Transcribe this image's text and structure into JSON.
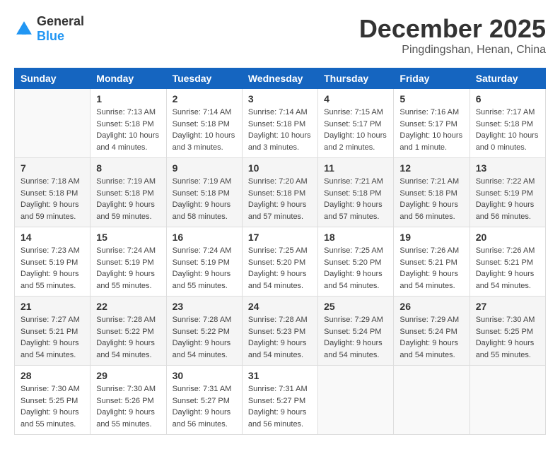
{
  "header": {
    "logo_general": "General",
    "logo_blue": "Blue",
    "month_title": "December 2025",
    "location": "Pingdingshan, Henan, China"
  },
  "weekdays": [
    "Sunday",
    "Monday",
    "Tuesday",
    "Wednesday",
    "Thursday",
    "Friday",
    "Saturday"
  ],
  "weeks": [
    [
      {
        "day": "",
        "info": ""
      },
      {
        "day": "1",
        "info": "Sunrise: 7:13 AM\nSunset: 5:18 PM\nDaylight: 10 hours\nand 4 minutes."
      },
      {
        "day": "2",
        "info": "Sunrise: 7:14 AM\nSunset: 5:18 PM\nDaylight: 10 hours\nand 3 minutes."
      },
      {
        "day": "3",
        "info": "Sunrise: 7:14 AM\nSunset: 5:18 PM\nDaylight: 10 hours\nand 3 minutes."
      },
      {
        "day": "4",
        "info": "Sunrise: 7:15 AM\nSunset: 5:17 PM\nDaylight: 10 hours\nand 2 minutes."
      },
      {
        "day": "5",
        "info": "Sunrise: 7:16 AM\nSunset: 5:17 PM\nDaylight: 10 hours\nand 1 minute."
      },
      {
        "day": "6",
        "info": "Sunrise: 7:17 AM\nSunset: 5:18 PM\nDaylight: 10 hours\nand 0 minutes."
      }
    ],
    [
      {
        "day": "7",
        "info": "Sunrise: 7:18 AM\nSunset: 5:18 PM\nDaylight: 9 hours\nand 59 minutes."
      },
      {
        "day": "8",
        "info": "Sunrise: 7:19 AM\nSunset: 5:18 PM\nDaylight: 9 hours\nand 59 minutes."
      },
      {
        "day": "9",
        "info": "Sunrise: 7:19 AM\nSunset: 5:18 PM\nDaylight: 9 hours\nand 58 minutes."
      },
      {
        "day": "10",
        "info": "Sunrise: 7:20 AM\nSunset: 5:18 PM\nDaylight: 9 hours\nand 57 minutes."
      },
      {
        "day": "11",
        "info": "Sunrise: 7:21 AM\nSunset: 5:18 PM\nDaylight: 9 hours\nand 57 minutes."
      },
      {
        "day": "12",
        "info": "Sunrise: 7:21 AM\nSunset: 5:18 PM\nDaylight: 9 hours\nand 56 minutes."
      },
      {
        "day": "13",
        "info": "Sunrise: 7:22 AM\nSunset: 5:19 PM\nDaylight: 9 hours\nand 56 minutes."
      }
    ],
    [
      {
        "day": "14",
        "info": "Sunrise: 7:23 AM\nSunset: 5:19 PM\nDaylight: 9 hours\nand 55 minutes."
      },
      {
        "day": "15",
        "info": "Sunrise: 7:24 AM\nSunset: 5:19 PM\nDaylight: 9 hours\nand 55 minutes."
      },
      {
        "day": "16",
        "info": "Sunrise: 7:24 AM\nSunset: 5:19 PM\nDaylight: 9 hours\nand 55 minutes."
      },
      {
        "day": "17",
        "info": "Sunrise: 7:25 AM\nSunset: 5:20 PM\nDaylight: 9 hours\nand 54 minutes."
      },
      {
        "day": "18",
        "info": "Sunrise: 7:25 AM\nSunset: 5:20 PM\nDaylight: 9 hours\nand 54 minutes."
      },
      {
        "day": "19",
        "info": "Sunrise: 7:26 AM\nSunset: 5:21 PM\nDaylight: 9 hours\nand 54 minutes."
      },
      {
        "day": "20",
        "info": "Sunrise: 7:26 AM\nSunset: 5:21 PM\nDaylight: 9 hours\nand 54 minutes."
      }
    ],
    [
      {
        "day": "21",
        "info": "Sunrise: 7:27 AM\nSunset: 5:21 PM\nDaylight: 9 hours\nand 54 minutes."
      },
      {
        "day": "22",
        "info": "Sunrise: 7:28 AM\nSunset: 5:22 PM\nDaylight: 9 hours\nand 54 minutes."
      },
      {
        "day": "23",
        "info": "Sunrise: 7:28 AM\nSunset: 5:22 PM\nDaylight: 9 hours\nand 54 minutes."
      },
      {
        "day": "24",
        "info": "Sunrise: 7:28 AM\nSunset: 5:23 PM\nDaylight: 9 hours\nand 54 minutes."
      },
      {
        "day": "25",
        "info": "Sunrise: 7:29 AM\nSunset: 5:24 PM\nDaylight: 9 hours\nand 54 minutes."
      },
      {
        "day": "26",
        "info": "Sunrise: 7:29 AM\nSunset: 5:24 PM\nDaylight: 9 hours\nand 54 minutes."
      },
      {
        "day": "27",
        "info": "Sunrise: 7:30 AM\nSunset: 5:25 PM\nDaylight: 9 hours\nand 55 minutes."
      }
    ],
    [
      {
        "day": "28",
        "info": "Sunrise: 7:30 AM\nSunset: 5:25 PM\nDaylight: 9 hours\nand 55 minutes."
      },
      {
        "day": "29",
        "info": "Sunrise: 7:30 AM\nSunset: 5:26 PM\nDaylight: 9 hours\nand 55 minutes."
      },
      {
        "day": "30",
        "info": "Sunrise: 7:31 AM\nSunset: 5:27 PM\nDaylight: 9 hours\nand 56 minutes."
      },
      {
        "day": "31",
        "info": "Sunrise: 7:31 AM\nSunset: 5:27 PM\nDaylight: 9 hours\nand 56 minutes."
      },
      {
        "day": "",
        "info": ""
      },
      {
        "day": "",
        "info": ""
      },
      {
        "day": "",
        "info": ""
      }
    ]
  ]
}
